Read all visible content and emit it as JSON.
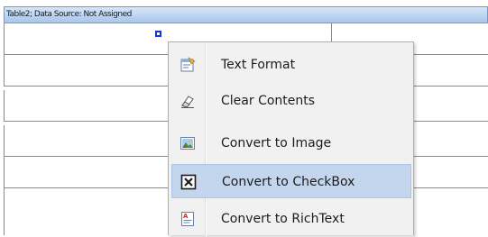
{
  "table": {
    "header_text": "Table2; Data Source: Not Assigned",
    "row_count": 5
  },
  "context_menu": {
    "items": [
      {
        "label": "Text Format",
        "icon": "text-format-icon"
      },
      {
        "label": "Clear Contents",
        "icon": "eraser-icon"
      },
      {
        "label": "Convert to Image",
        "icon": "image-icon"
      },
      {
        "label": "Convert to CheckBox",
        "icon": "checkbox-icon",
        "highlighted": true
      },
      {
        "label": "Convert to RichText",
        "icon": "richtext-icon"
      }
    ]
  },
  "colors": {
    "header_gradient_top": "#d6e6f8",
    "header_gradient_bottom": "#a9c6ea",
    "menu_background": "#f1f1f1",
    "menu_highlight": "#c4d6ee",
    "selection_handle": "#1c35c8"
  }
}
